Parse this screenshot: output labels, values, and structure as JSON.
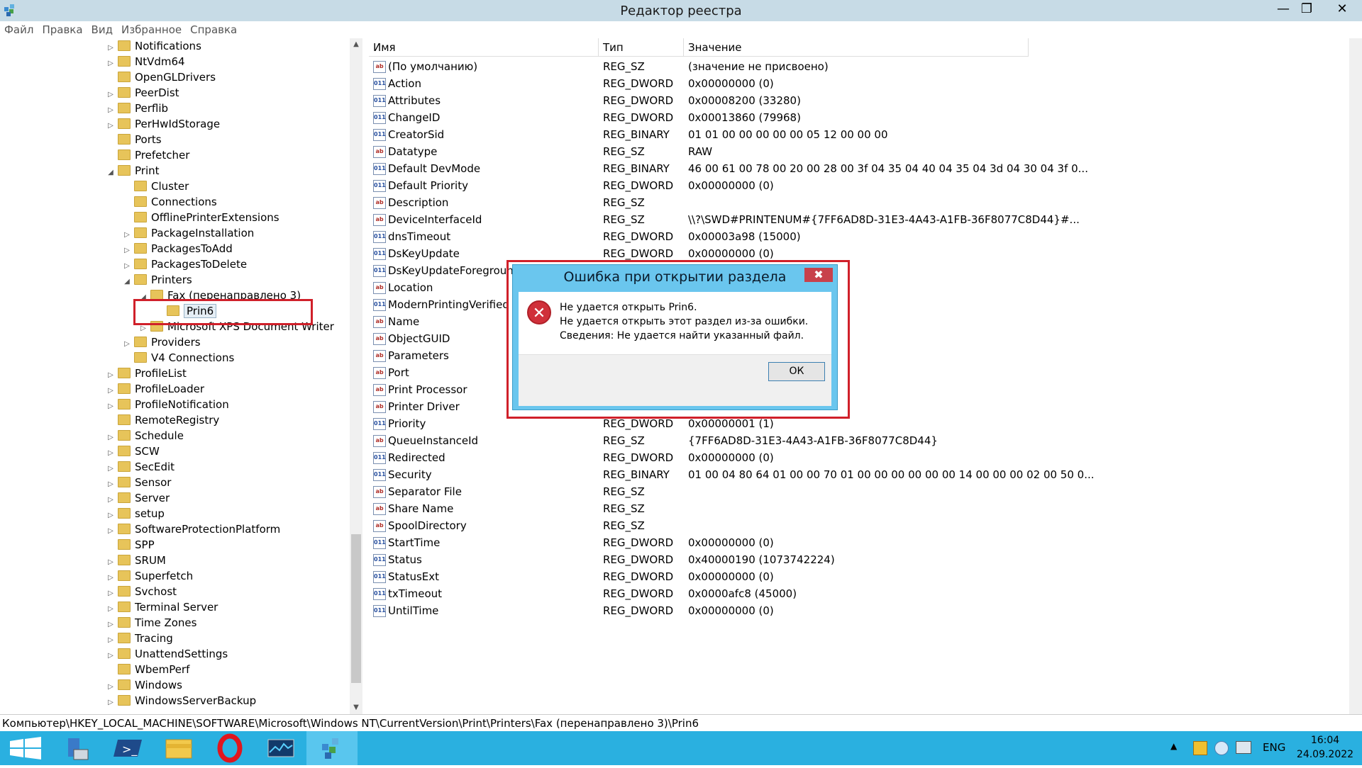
{
  "window": {
    "title": "Редактор реестра",
    "controls": {
      "minimize": "—",
      "maximize": "❐",
      "close": "✕"
    }
  },
  "menu": [
    "Файл",
    "Правка",
    "Вид",
    "Избранное",
    "Справка"
  ],
  "tree": {
    "items": [
      {
        "label": "Notifications",
        "level": 0,
        "expander": "closed"
      },
      {
        "label": "NtVdm64",
        "level": 0,
        "expander": "closed"
      },
      {
        "label": "OpenGLDrivers",
        "level": 0,
        "expander": "none"
      },
      {
        "label": "PeerDist",
        "level": 0,
        "expander": "closed"
      },
      {
        "label": "Perflib",
        "level": 0,
        "expander": "closed"
      },
      {
        "label": "PerHwIdStorage",
        "level": 0,
        "expander": "closed"
      },
      {
        "label": "Ports",
        "level": 0,
        "expander": "none"
      },
      {
        "label": "Prefetcher",
        "level": 0,
        "expander": "none"
      },
      {
        "label": "Print",
        "level": 0,
        "expander": "open"
      },
      {
        "label": "Cluster",
        "level": 1,
        "expander": "none"
      },
      {
        "label": "Connections",
        "level": 1,
        "expander": "none"
      },
      {
        "label": "OfflinePrinterExtensions",
        "level": 1,
        "expander": "none"
      },
      {
        "label": "PackageInstallation",
        "level": 1,
        "expander": "closed"
      },
      {
        "label": "PackagesToAdd",
        "level": 1,
        "expander": "closed"
      },
      {
        "label": "PackagesToDelete",
        "level": 1,
        "expander": "closed"
      },
      {
        "label": "Printers",
        "level": 1,
        "expander": "open"
      },
      {
        "label": "Fax (перенаправлено 3)",
        "level": 2,
        "expander": "open"
      },
      {
        "label": "Prin6",
        "level": 3,
        "expander": "none",
        "selected": true
      },
      {
        "label": "Microsoft XPS Document Writer",
        "level": 2,
        "expander": "closed"
      },
      {
        "label": "Providers",
        "level": 1,
        "expander": "closed"
      },
      {
        "label": "V4 Connections",
        "level": 1,
        "expander": "none"
      },
      {
        "label": "ProfileList",
        "level": 0,
        "expander": "closed"
      },
      {
        "label": "ProfileLoader",
        "level": 0,
        "expander": "closed"
      },
      {
        "label": "ProfileNotification",
        "level": 0,
        "expander": "closed"
      },
      {
        "label": "RemoteRegistry",
        "level": 0,
        "expander": "none"
      },
      {
        "label": "Schedule",
        "level": 0,
        "expander": "closed"
      },
      {
        "label": "SCW",
        "level": 0,
        "expander": "closed"
      },
      {
        "label": "SecEdit",
        "level": 0,
        "expander": "closed"
      },
      {
        "label": "Sensor",
        "level": 0,
        "expander": "closed"
      },
      {
        "label": "Server",
        "level": 0,
        "expander": "closed"
      },
      {
        "label": "setup",
        "level": 0,
        "expander": "closed"
      },
      {
        "label": "SoftwareProtectionPlatform",
        "level": 0,
        "expander": "closed"
      },
      {
        "label": "SPP",
        "level": 0,
        "expander": "none"
      },
      {
        "label": "SRUM",
        "level": 0,
        "expander": "closed"
      },
      {
        "label": "Superfetch",
        "level": 0,
        "expander": "closed"
      },
      {
        "label": "Svchost",
        "level": 0,
        "expander": "closed"
      },
      {
        "label": "Terminal Server",
        "level": 0,
        "expander": "closed"
      },
      {
        "label": "Time Zones",
        "level": 0,
        "expander": "closed"
      },
      {
        "label": "Tracing",
        "level": 0,
        "expander": "closed"
      },
      {
        "label": "UnattendSettings",
        "level": 0,
        "expander": "closed"
      },
      {
        "label": "WbemPerf",
        "level": 0,
        "expander": "none"
      },
      {
        "label": "Windows",
        "level": 0,
        "expander": "closed"
      },
      {
        "label": "WindowsServerBackup",
        "level": 0,
        "expander": "closed"
      }
    ]
  },
  "list": {
    "headers": {
      "name": "Имя",
      "type": "Тип",
      "value": "Значение"
    },
    "rows": [
      {
        "name": "(По умолчанию)",
        "type": "REG_SZ",
        "value": "(значение не присвоено)",
        "icon": "string"
      },
      {
        "name": "Action",
        "type": "REG_DWORD",
        "value": "0x00000000 (0)",
        "icon": "binary"
      },
      {
        "name": "Attributes",
        "type": "REG_DWORD",
        "value": "0x00008200 (33280)",
        "icon": "binary"
      },
      {
        "name": "ChangeID",
        "type": "REG_DWORD",
        "value": "0x00013860 (79968)",
        "icon": "binary"
      },
      {
        "name": "CreatorSid",
        "type": "REG_BINARY",
        "value": "01 01 00 00 00 00 00 05 12 00 00 00",
        "icon": "binary"
      },
      {
        "name": "Datatype",
        "type": "REG_SZ",
        "value": "RAW",
        "icon": "string"
      },
      {
        "name": "Default DevMode",
        "type": "REG_BINARY",
        "value": "46 00 61 00 78 00 20 00 28 00 3f 04 35 04 40 04 35 04 3d 04 30 04 3f 0...",
        "icon": "binary"
      },
      {
        "name": "Default Priority",
        "type": "REG_DWORD",
        "value": "0x00000000 (0)",
        "icon": "binary"
      },
      {
        "name": "Description",
        "type": "REG_SZ",
        "value": "",
        "icon": "string"
      },
      {
        "name": "DeviceInterfaceId",
        "type": "REG_SZ",
        "value": "\\\\?\\SWD#PRINTENUM#{7FF6AD8D-31E3-4A43-A1FB-36F8077C8D44}#...",
        "icon": "string"
      },
      {
        "name": "dnsTimeout",
        "type": "REG_DWORD",
        "value": "0x00003a98 (15000)",
        "icon": "binary"
      },
      {
        "name": "DsKeyUpdate",
        "type": "REG_DWORD",
        "value": "0x00000000 (0)",
        "icon": "binary"
      },
      {
        "name": "DsKeyUpdateForeground",
        "type": "",
        "value": "",
        "icon": "binary"
      },
      {
        "name": "Location",
        "type": "",
        "value": "",
        "icon": "string"
      },
      {
        "name": "ModernPrintingVerified",
        "type": "",
        "value": "",
        "icon": "binary"
      },
      {
        "name": "Name",
        "type": "",
        "value": "",
        "icon": "string"
      },
      {
        "name": "ObjectGUID",
        "type": "",
        "value": "",
        "icon": "string"
      },
      {
        "name": "Parameters",
        "type": "",
        "value": "",
        "icon": "string"
      },
      {
        "name": "Port",
        "type": "",
        "value": "",
        "icon": "string"
      },
      {
        "name": "Print Processor",
        "type": "",
        "value": "",
        "icon": "string"
      },
      {
        "name": "Printer Driver",
        "type": "",
        "value": "",
        "icon": "string"
      },
      {
        "name": "Priority",
        "type": "REG_DWORD",
        "value": "0x00000001 (1)",
        "icon": "binary"
      },
      {
        "name": "QueueInstanceId",
        "type": "REG_SZ",
        "value": "{7FF6AD8D-31E3-4A43-A1FB-36F8077C8D44}",
        "icon": "string"
      },
      {
        "name": "Redirected",
        "type": "REG_DWORD",
        "value": "0x00000000 (0)",
        "icon": "binary"
      },
      {
        "name": "Security",
        "type": "REG_BINARY",
        "value": "01 00 04 80 64 01 00 00 70 01 00 00 00 00 00 00 14 00 00 00 02 00 50 0...",
        "icon": "binary"
      },
      {
        "name": "Separator File",
        "type": "REG_SZ",
        "value": "",
        "icon": "string"
      },
      {
        "name": "Share Name",
        "type": "REG_SZ",
        "value": "",
        "icon": "string"
      },
      {
        "name": "SpoolDirectory",
        "type": "REG_SZ",
        "value": "",
        "icon": "string"
      },
      {
        "name": "StartTime",
        "type": "REG_DWORD",
        "value": "0x00000000 (0)",
        "icon": "binary"
      },
      {
        "name": "Status",
        "type": "REG_DWORD",
        "value": "0x40000190 (1073742224)",
        "icon": "binary"
      },
      {
        "name": "StatusExt",
        "type": "REG_DWORD",
        "value": "0x00000000 (0)",
        "icon": "binary"
      },
      {
        "name": "txTimeout",
        "type": "REG_DWORD",
        "value": "0x0000afc8 (45000)",
        "icon": "binary"
      },
      {
        "name": "UntilTime",
        "type": "REG_DWORD",
        "value": "0x00000000 (0)",
        "icon": "binary"
      }
    ]
  },
  "status_path": "Компьютер\\HKEY_LOCAL_MACHINE\\SOFTWARE\\Microsoft\\Windows NT\\CurrentVersion\\Print\\Printers\\Fax (перенаправлено 3)\\Prin6",
  "dialog": {
    "title": "Ошибка при открытии раздела",
    "close": "✖",
    "lines": [
      "Не удается открыть Prin6.",
      "Не удается открыть этот раздел из-за ошибки.",
      "Сведения: Не удается найти указанный файл."
    ],
    "ok_label": "ОК"
  },
  "taskbar": {
    "apps": [
      "start-button",
      "server-manager",
      "powershell",
      "file-explorer",
      "opera",
      "task-manager",
      "registry-editor"
    ],
    "lang": "ENG",
    "time": "16:04",
    "date": "24.09.2022"
  },
  "colors": {
    "titlebar": "#c7dbe6",
    "taskbar": "#2ab0e0",
    "highlight_box": "#d0202a",
    "dialog_frame": "#6ac6ee"
  }
}
